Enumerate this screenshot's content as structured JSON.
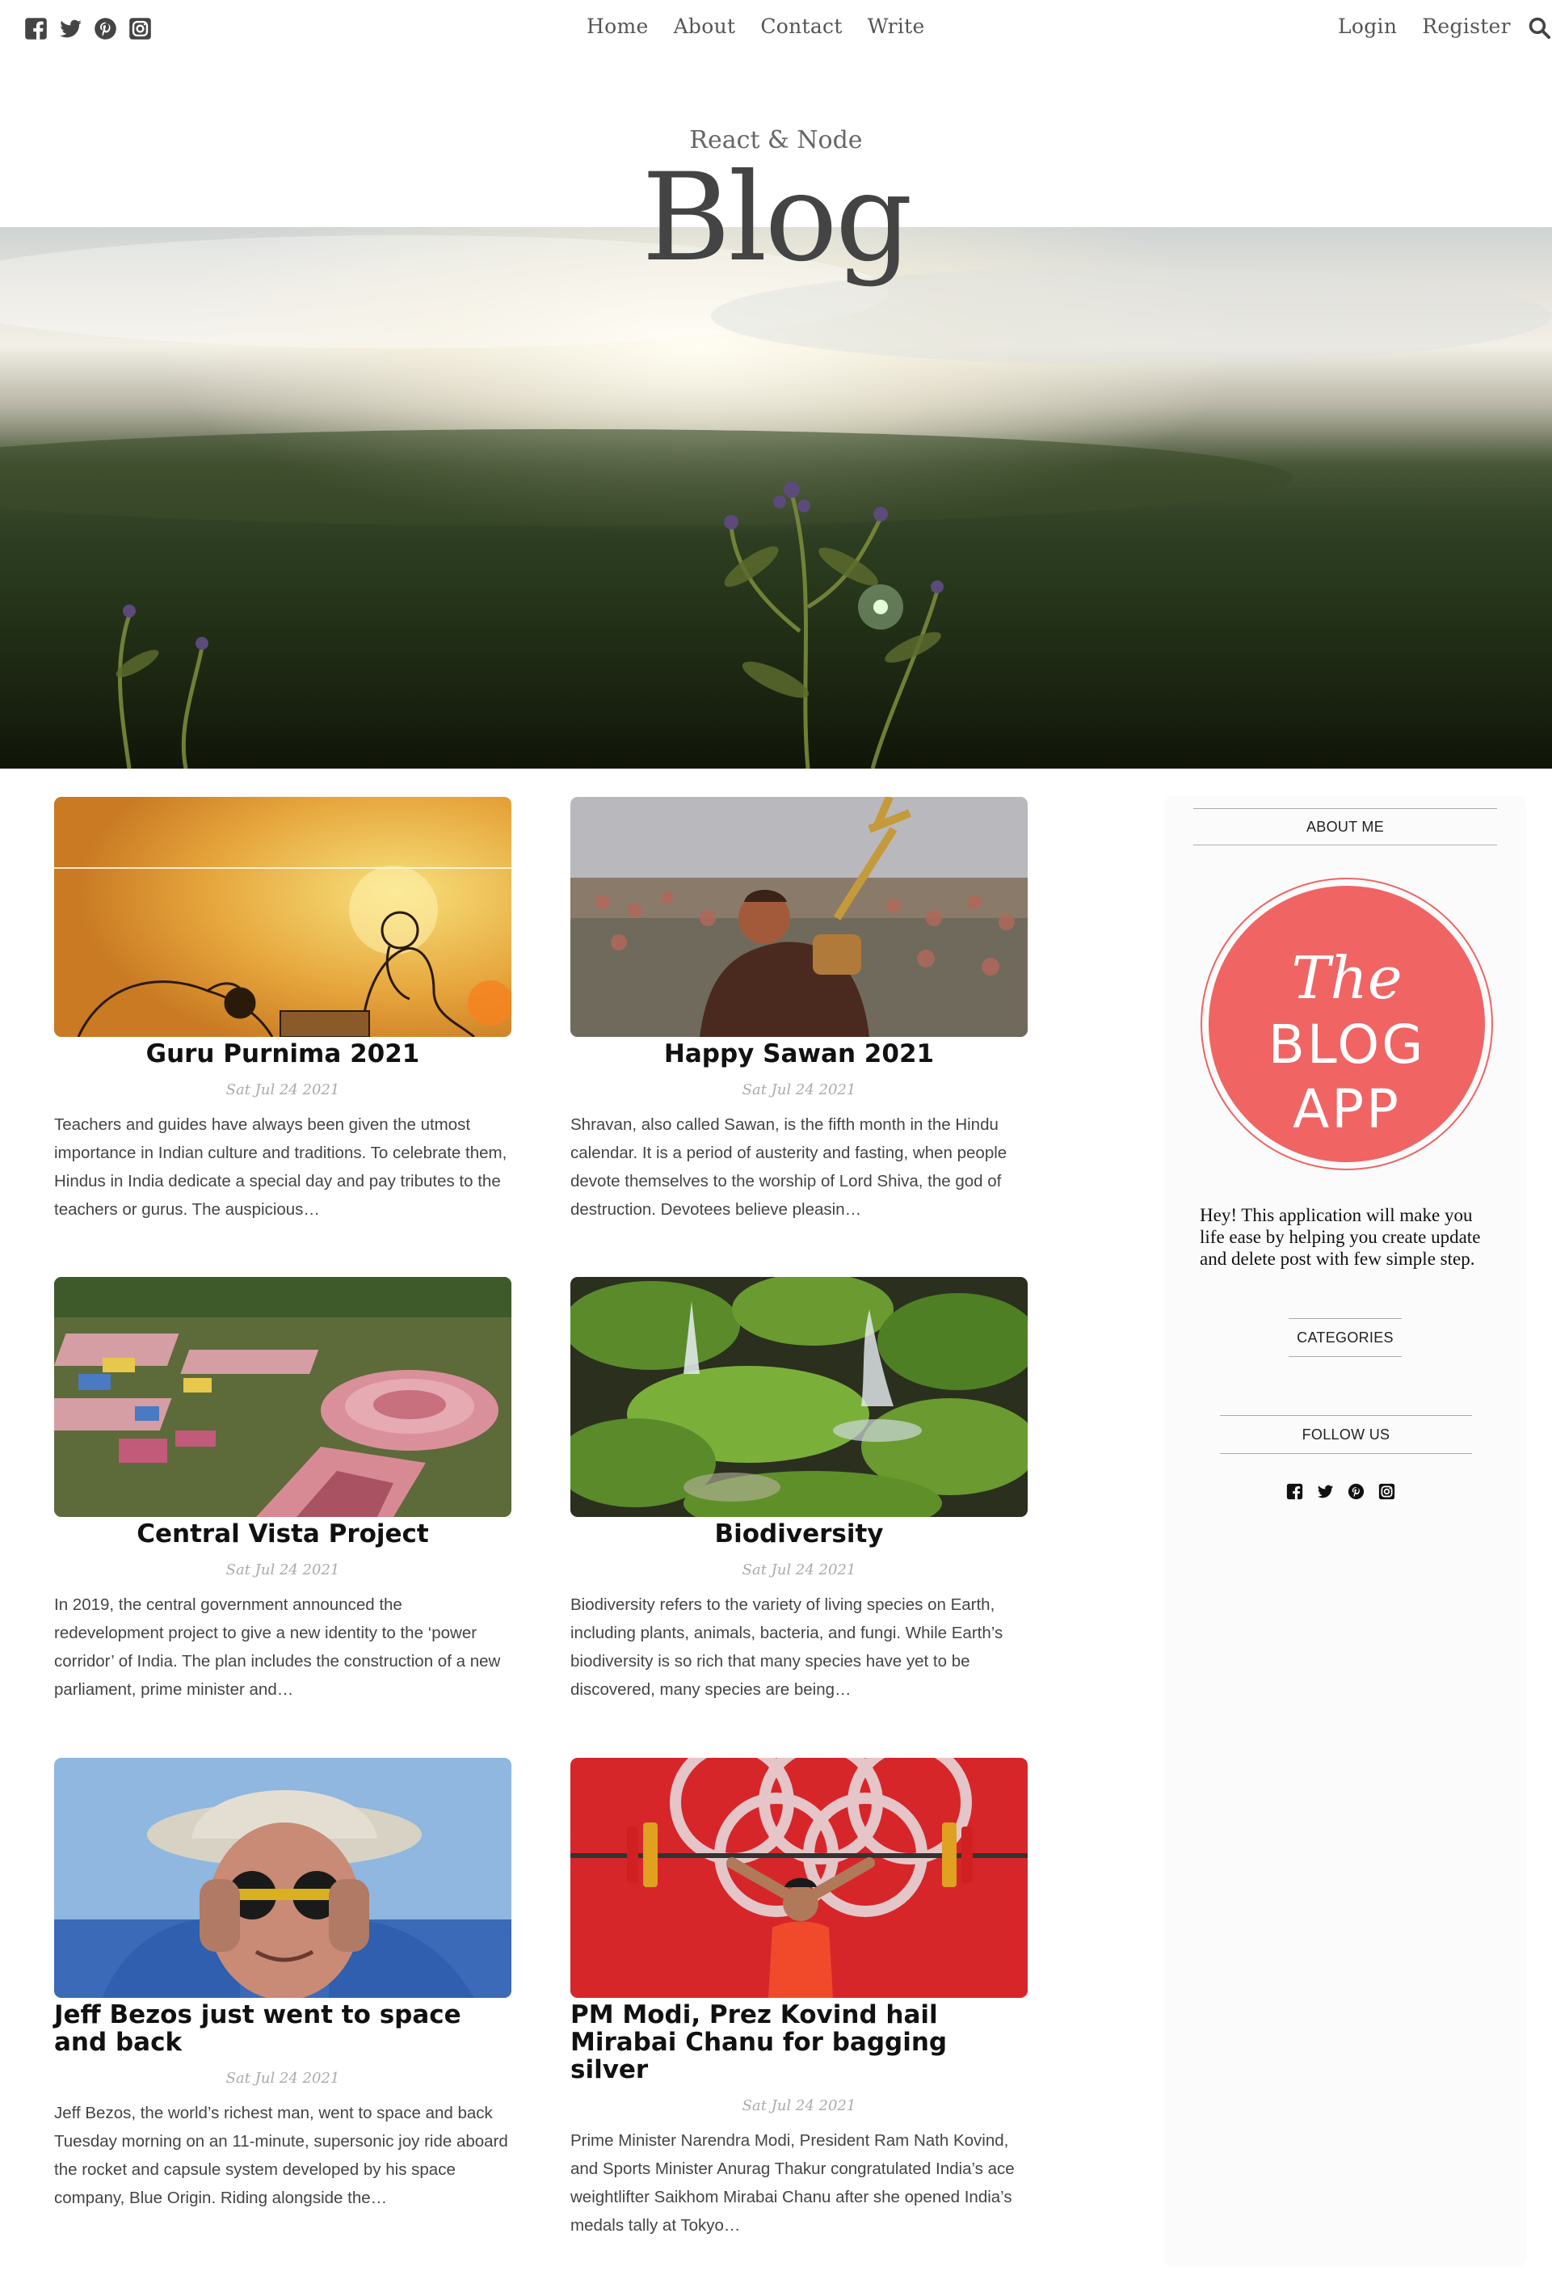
{
  "nav": {
    "social": [
      "facebook-icon",
      "twitter-icon",
      "pinterest-icon",
      "instagram-icon"
    ],
    "links": [
      "Home",
      "About",
      "Contact",
      "Write"
    ],
    "login": "Login",
    "register": "Register"
  },
  "header": {
    "subtitle": "React & Node",
    "title": "Blog"
  },
  "posts": [
    {
      "title": "Guru Purnima 2021",
      "date": "Sat Jul 24 2021",
      "desc": "Teachers and guides have always been given the utmost importance in Indian culture and traditions. To celebrate them, Hindus in India dedicate a special day and pay tributes to the teachers or gurus. The auspicious…"
    },
    {
      "title": "Happy Sawan 2021",
      "date": "Sat Jul 24 2021",
      "desc": "Shravan, also called Sawan, is the fifth month in the Hindu calendar. It is a period of austerity and fasting, when people devote themselves to the worship of Lord Shiva, the god of destruction. Devotees believe pleasin…"
    },
    {
      "title": "Central Vista Project",
      "date": "Sat Jul 24 2021",
      "desc": "In 2019, the central government announced the redevelopment project to give a new identity to the ‘power corridor’ of India. The plan includes the construction of a new parliament, prime minister and…"
    },
    {
      "title": "Biodiversity",
      "date": "Sat Jul 24 2021",
      "desc": "Biodiversity refers to the variety of living species on Earth, including plants, animals, bacteria, and fungi. While Earth’s biodiversity is so rich that many species have yet to be discovered, many species are being…"
    },
    {
      "title": "Jeff Bezos just went to space and back",
      "date": "Sat Jul 24 2021",
      "desc": "Jeff Bezos, the world’s richest man, went to space and back Tuesday morning on an 11-minute, supersonic joy ride aboard the rocket and capsule system developed by his space company, Blue Origin. Riding alongside the…"
    },
    {
      "title": "PM Modi, Prez Kovind hail Mirabai Chanu for bagging silver",
      "date": "Sat Jul 24 2021",
      "desc": "Prime Minister Narendra Modi, President Ram Nath Kovind, and Sports Minister Anurag Thakur congratulated India’s ace weightlifter Saikhom Mirabai Chanu after she opened India’s medals tally at Tokyo…"
    }
  ],
  "sidebar": {
    "about_heading": "ABOUT ME",
    "logo": {
      "line1": "The",
      "line2": "BLOG",
      "line3": "APP",
      "color": "#f06464"
    },
    "about_text": "Hey! This application will make you life ease by helping you create update and delete post with few simple step.",
    "categories_heading": "CATEGORIES",
    "follow_heading": "FOLLOW US",
    "social": [
      "facebook-icon",
      "twitter-icon",
      "pinterest-icon",
      "instagram-icon"
    ]
  }
}
